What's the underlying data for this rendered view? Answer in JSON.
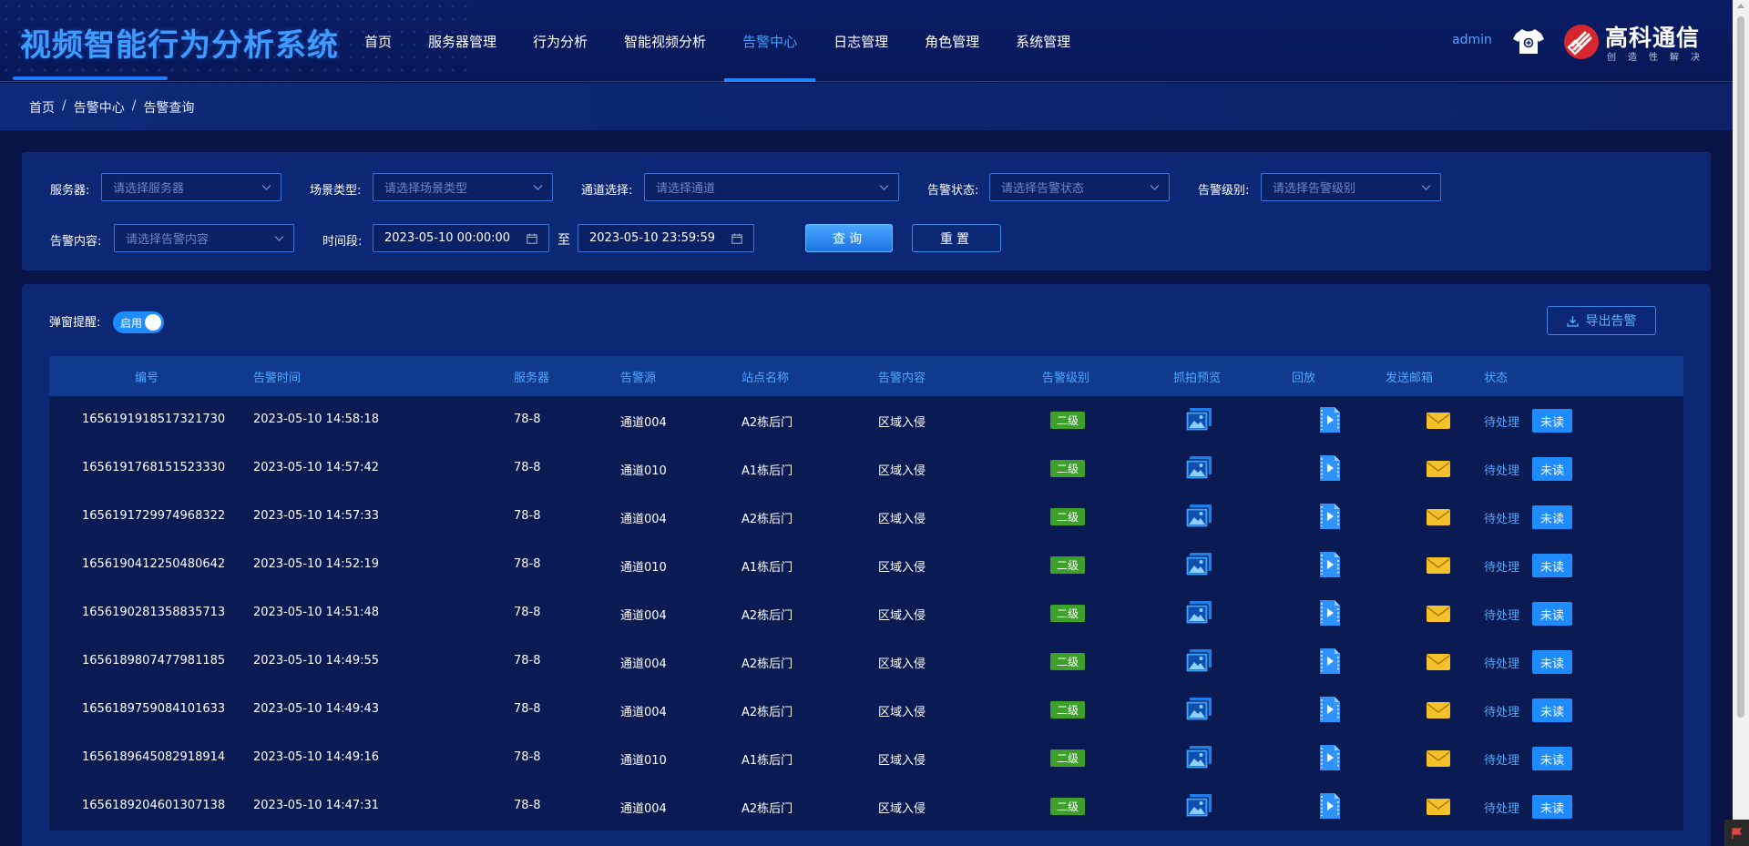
{
  "header": {
    "app_title": "视频智能行为分析系统",
    "nav": [
      "首页",
      "服务器管理",
      "行为分析",
      "智能视频分析",
      "告警中心",
      "日志管理",
      "角色管理",
      "系统管理"
    ],
    "active_nav": "告警中心",
    "user": "admin",
    "icons": {
      "theme": "tshirt-icon"
    },
    "brand": {
      "name": "高科通信",
      "slogan": "创造性解决"
    }
  },
  "breadcrumb": [
    "首页",
    "告警中心",
    "告警查询"
  ],
  "filters": {
    "server": {
      "label": "服务器:",
      "placeholder": "请选择服务器"
    },
    "scene": {
      "label": "场景类型:",
      "placeholder": "请选择场景类型"
    },
    "channel": {
      "label": "通道选择:",
      "placeholder": "请选择通道"
    },
    "status": {
      "label": "告警状态:",
      "placeholder": "请选择告警状态"
    },
    "level": {
      "label": "告警级别:",
      "placeholder": "请选择告警级别"
    },
    "content": {
      "label": "告警内容:",
      "placeholder": "请选择告警内容"
    },
    "time": {
      "label": "时间段:",
      "start": "2023-05-10 00:00:00",
      "to": "至",
      "end": "2023-05-10 23:59:59"
    },
    "query_label": "查询",
    "reset_label": "重置"
  },
  "toolbar": {
    "popup_label": "弹窗提醒:",
    "popup_toggle_text": "启用",
    "popup_enabled": true,
    "export_label": "导出告警"
  },
  "table": {
    "columns": [
      "编号",
      "告警时间",
      "服务器",
      "告警源",
      "站点名称",
      "告警内容",
      "告警级别",
      "抓拍预览",
      "回放",
      "发送邮箱",
      "状态"
    ],
    "rows": [
      {
        "id": "1656191918517321730",
        "time": "2023-05-10 14:58:18",
        "server": "78-8",
        "source": "通道004",
        "site": "A2栋后门",
        "content": "区域入侵",
        "level": "二级",
        "status": "待处理",
        "read": "未读"
      },
      {
        "id": "1656191768151523330",
        "time": "2023-05-10 14:57:42",
        "server": "78-8",
        "source": "通道010",
        "site": "A1栋后门",
        "content": "区域入侵",
        "level": "二级",
        "status": "待处理",
        "read": "未读"
      },
      {
        "id": "1656191729974968322",
        "time": "2023-05-10 14:57:33",
        "server": "78-8",
        "source": "通道004",
        "site": "A2栋后门",
        "content": "区域入侵",
        "level": "二级",
        "status": "待处理",
        "read": "未读"
      },
      {
        "id": "1656190412250480642",
        "time": "2023-05-10 14:52:19",
        "server": "78-8",
        "source": "通道010",
        "site": "A1栋后门",
        "content": "区域入侵",
        "level": "二级",
        "status": "待处理",
        "read": "未读"
      },
      {
        "id": "1656190281358835713",
        "time": "2023-05-10 14:51:48",
        "server": "78-8",
        "source": "通道004",
        "site": "A2栋后门",
        "content": "区域入侵",
        "level": "二级",
        "status": "待处理",
        "read": "未读"
      },
      {
        "id": "1656189807477981185",
        "time": "2023-05-10 14:49:55",
        "server": "78-8",
        "source": "通道004",
        "site": "A2栋后门",
        "content": "区域入侵",
        "level": "二级",
        "status": "待处理",
        "read": "未读"
      },
      {
        "id": "1656189759084101633",
        "time": "2023-05-10 14:49:43",
        "server": "78-8",
        "source": "通道004",
        "site": "A2栋后门",
        "content": "区域入侵",
        "level": "二级",
        "status": "待处理",
        "read": "未读"
      },
      {
        "id": "1656189645082918914",
        "time": "2023-05-10 14:49:16",
        "server": "78-8",
        "source": "通道010",
        "site": "A1栋后门",
        "content": "区域入侵",
        "level": "二级",
        "status": "待处理",
        "read": "未读"
      },
      {
        "id": "1656189204601307138",
        "time": "2023-05-10 14:47:31",
        "server": "78-8",
        "source": "通道004",
        "site": "A2栋后门",
        "content": "区域入侵",
        "level": "二级",
        "status": "待处理",
        "read": "未读"
      }
    ]
  },
  "colors": {
    "background": "#071445",
    "accent": "#1e8cff",
    "level_badge": "#3ca02a",
    "mail_icon": "#f5c12b"
  }
}
